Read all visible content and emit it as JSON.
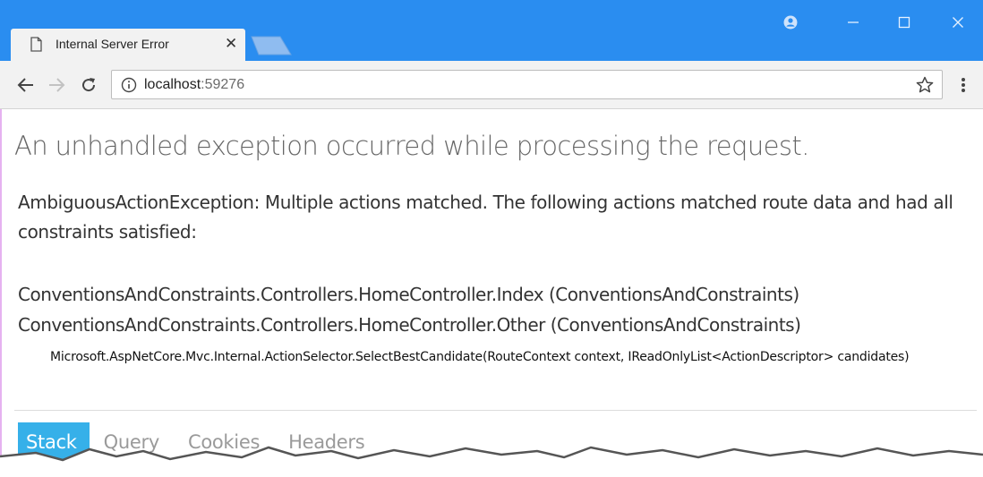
{
  "browser": {
    "tab": {
      "title": "Internal Server Error",
      "close_glyph": "✕"
    },
    "window_controls": {
      "minimize": "—",
      "maximize": "☐",
      "close": "✕"
    },
    "address_bar": {
      "host": "localhost",
      "port": ":59276"
    },
    "icons": [
      "page-icon",
      "profile-icon",
      "back-arrow-icon",
      "forward-arrow-icon",
      "reload-icon",
      "info-icon",
      "star-icon",
      "more-menu-icon"
    ],
    "colors": {
      "titlebar": "#2a8df0",
      "toolbar": "#f2f2f2",
      "active_tab_accent": "#36b0e9"
    }
  },
  "page": {
    "heading": "An unhandled exception occurred while processing the request.",
    "exception_message": "AmbiguousActionException: Multiple actions matched. The following actions matched route data and had all constraints satisfied:",
    "matched_actions": [
      "ConventionsAndConstraints.Controllers.HomeController.Index (ConventionsAndConstraints)",
      "ConventionsAndConstraints.Controllers.HomeController.Other (ConventionsAndConstraints)"
    ],
    "location": "Microsoft.AspNetCore.Mvc.Internal.ActionSelector.SelectBestCandidate(RouteContext context, IReadOnlyList<ActionDescriptor> candidates)",
    "tabs": [
      "Stack",
      "Query",
      "Cookies",
      "Headers"
    ],
    "active_tab": "Stack"
  }
}
